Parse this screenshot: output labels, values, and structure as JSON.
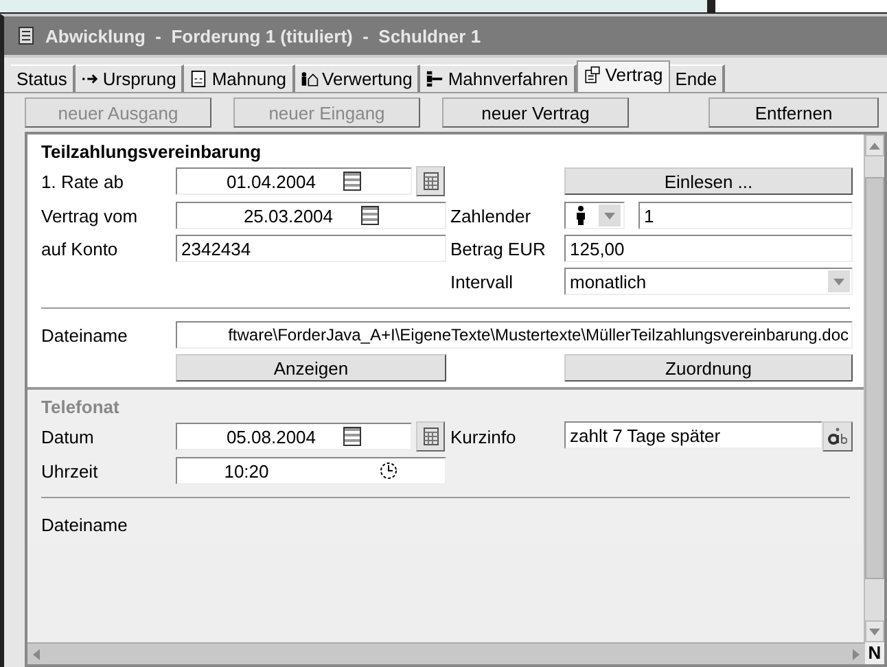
{
  "window": {
    "title": "Abwicklung  -  Forderung 1 (tituliert)  -  Schuldner 1"
  },
  "tabs": [
    {
      "label": "Status",
      "selected": false
    },
    {
      "label": "Ursprung",
      "selected": false
    },
    {
      "label": "Mahnung",
      "selected": false
    },
    {
      "label": "Verwertung",
      "selected": false
    },
    {
      "label": "Mahnverfahren",
      "selected": false
    },
    {
      "label": "Vertrag",
      "selected": true
    },
    {
      "label": "Ende",
      "selected": false
    }
  ],
  "actions": [
    {
      "label": "neuer Ausgang",
      "disabled": true
    },
    {
      "label": "neuer Eingang",
      "disabled": true
    },
    {
      "label": "neuer Vertrag",
      "disabled": false
    },
    {
      "label": "Entfernen",
      "disabled": false
    }
  ],
  "agreement": {
    "heading": "Teilzahlungsvereinbarung",
    "first_rate": {
      "label": "1. Rate ab",
      "value": "01.04.2004"
    },
    "read_button": "Einlesen ...",
    "contract_date": {
      "label": "Vertrag vom",
      "value": "25.03.2004"
    },
    "payer": {
      "label": "Zahlender",
      "value": "1"
    },
    "account": {
      "label": "auf Konto",
      "value": "2342434"
    },
    "amount": {
      "label": "Betrag EUR",
      "value": "125,00"
    },
    "interval": {
      "label": "Intervall",
      "value": "monatlich"
    },
    "file": {
      "label": "Dateiname",
      "value": "ftware\\ForderJava_A+I\\EigeneTexte\\Mustertexte\\MüllerTeilzahlungsvereinbarung.doc"
    },
    "show_button": "Anzeigen",
    "assign_button": "Zuordnung"
  },
  "call": {
    "heading": "Telefonat",
    "date": {
      "label": "Datum",
      "value": "05.08.2004"
    },
    "note": {
      "label": "Kurzinfo",
      "value": "zahlt 7 Tage später"
    },
    "time": {
      "label": "Uhrzeit",
      "value": "10:20"
    },
    "file": {
      "label": "Dateiname"
    }
  },
  "corner": "N"
}
